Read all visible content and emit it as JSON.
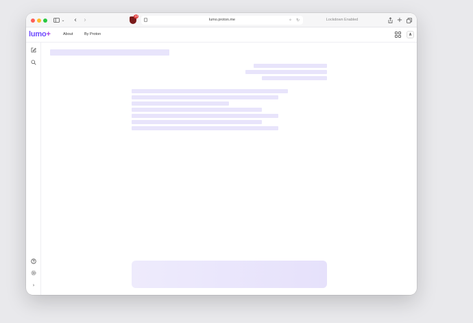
{
  "browser": {
    "url": "lumo.proton.me",
    "lockdown_label": "Lockdown Enabled",
    "shield_badge": "10",
    "traffic_colors": {
      "close": "#ff5f57",
      "minimize": "#febc2e",
      "zoom": "#28c840"
    }
  },
  "app": {
    "logo_text": "lumo",
    "logo_plus": "+",
    "nav": {
      "about": "About",
      "by_proton": "By Proton"
    },
    "avatar_initial": "A",
    "accent_color": "#6d4aff"
  },
  "sidebar": {
    "top_icons": [
      "compose-icon",
      "search-icon"
    ],
    "bottom_icons": [
      "help-icon",
      "settings-icon",
      "expand-icon"
    ]
  }
}
